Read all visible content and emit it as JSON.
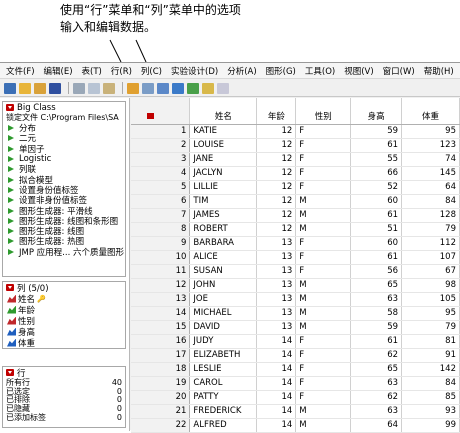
{
  "annotation": {
    "line1": "使用“行”菜单和“列”菜单中的选项",
    "line2": "输入和编辑数据。"
  },
  "menu": [
    "文件(F)",
    "编辑(E)",
    "表(T)",
    "行(R)",
    "列(C)",
    "实验设计(D)",
    "分析(A)",
    "图形(G)",
    "工具(O)",
    "视图(V)",
    "窗口(W)",
    "帮助(H)"
  ],
  "toolbar_icons": [
    "new-table-icon",
    "open-icon",
    "folder-icon",
    "save-icon",
    "cut-icon",
    "copy-icon",
    "paste-icon",
    "data-table-icon",
    "grid-icon",
    "formula-icon",
    "distribution-icon",
    "graph-builder-icon",
    "fit-model-icon",
    "wand-icon"
  ],
  "table_panel": {
    "title": "Big Class",
    "source": "锁定文件 C:\\Program Files\\SA",
    "scripts": [
      "分布",
      "二元",
      "单因子",
      "Logistic",
      "列联",
      "拟合模型",
      "设置身份值标签",
      "设置非身份值标签",
      "图形生成器: 平滑线",
      "图形生成器: 线图和条形图",
      "图形生成器: 线图",
      "图形生成器: 热图",
      "JMP 应用程... 六个质量图形"
    ]
  },
  "columns_panel": {
    "title": "列 (5/0)",
    "items": [
      {
        "name": "姓名",
        "type": "nominal",
        "extra": "key"
      },
      {
        "name": "年龄",
        "type": "ordinal"
      },
      {
        "name": "性别",
        "type": "nominal"
      },
      {
        "name": "身高",
        "type": "continuous"
      },
      {
        "name": "体重",
        "type": "continuous"
      }
    ]
  },
  "rows_panel": {
    "title": "行",
    "stats": [
      {
        "label": "所有行",
        "value": "40"
      },
      {
        "label": "已选定",
        "value": "0"
      },
      {
        "label": "已排除",
        "value": "0"
      },
      {
        "label": "已隐藏",
        "value": "0"
      },
      {
        "label": "已添加标签",
        "value": "0"
      }
    ]
  },
  "table": {
    "headers": [
      "姓名",
      "年龄",
      "性别",
      "身高",
      "体重"
    ],
    "rows": [
      [
        "1",
        "KATIE",
        "12",
        "F",
        "59",
        "95"
      ],
      [
        "2",
        "LOUISE",
        "12",
        "F",
        "61",
        "123"
      ],
      [
        "3",
        "JANE",
        "12",
        "F",
        "55",
        "74"
      ],
      [
        "4",
        "JACLYN",
        "12",
        "F",
        "66",
        "145"
      ],
      [
        "5",
        "LILLIE",
        "12",
        "F",
        "52",
        "64"
      ],
      [
        "6",
        "TIM",
        "12",
        "M",
        "60",
        "84"
      ],
      [
        "7",
        "JAMES",
        "12",
        "M",
        "61",
        "128"
      ],
      [
        "8",
        "ROBERT",
        "12",
        "M",
        "51",
        "79"
      ],
      [
        "9",
        "BARBARA",
        "13",
        "F",
        "60",
        "112"
      ],
      [
        "10",
        "ALICE",
        "13",
        "F",
        "61",
        "107"
      ],
      [
        "11",
        "SUSAN",
        "13",
        "F",
        "56",
        "67"
      ],
      [
        "12",
        "JOHN",
        "13",
        "M",
        "65",
        "98"
      ],
      [
        "13",
        "JOE",
        "13",
        "M",
        "63",
        "105"
      ],
      [
        "14",
        "MICHAEL",
        "13",
        "M",
        "58",
        "95"
      ],
      [
        "15",
        "DAVID",
        "13",
        "M",
        "59",
        "79"
      ],
      [
        "16",
        "JUDY",
        "14",
        "F",
        "61",
        "81"
      ],
      [
        "17",
        "ELIZABETH",
        "14",
        "F",
        "62",
        "91"
      ],
      [
        "18",
        "LESLIE",
        "14",
        "F",
        "65",
        "142"
      ],
      [
        "19",
        "CAROL",
        "14",
        "F",
        "63",
        "84"
      ],
      [
        "20",
        "PATTY",
        "14",
        "F",
        "62",
        "85"
      ],
      [
        "21",
        "FREDERICK",
        "14",
        "M",
        "63",
        "93"
      ],
      [
        "22",
        "ALFRED",
        "14",
        "M",
        "64",
        "99"
      ]
    ]
  },
  "colors": {
    "red_triangle": "#c00000",
    "script_play": "#2e9a2e",
    "continuous": "#1f5fbf",
    "nominal": "#c0282c",
    "ordinal": "#2e9a2e"
  }
}
